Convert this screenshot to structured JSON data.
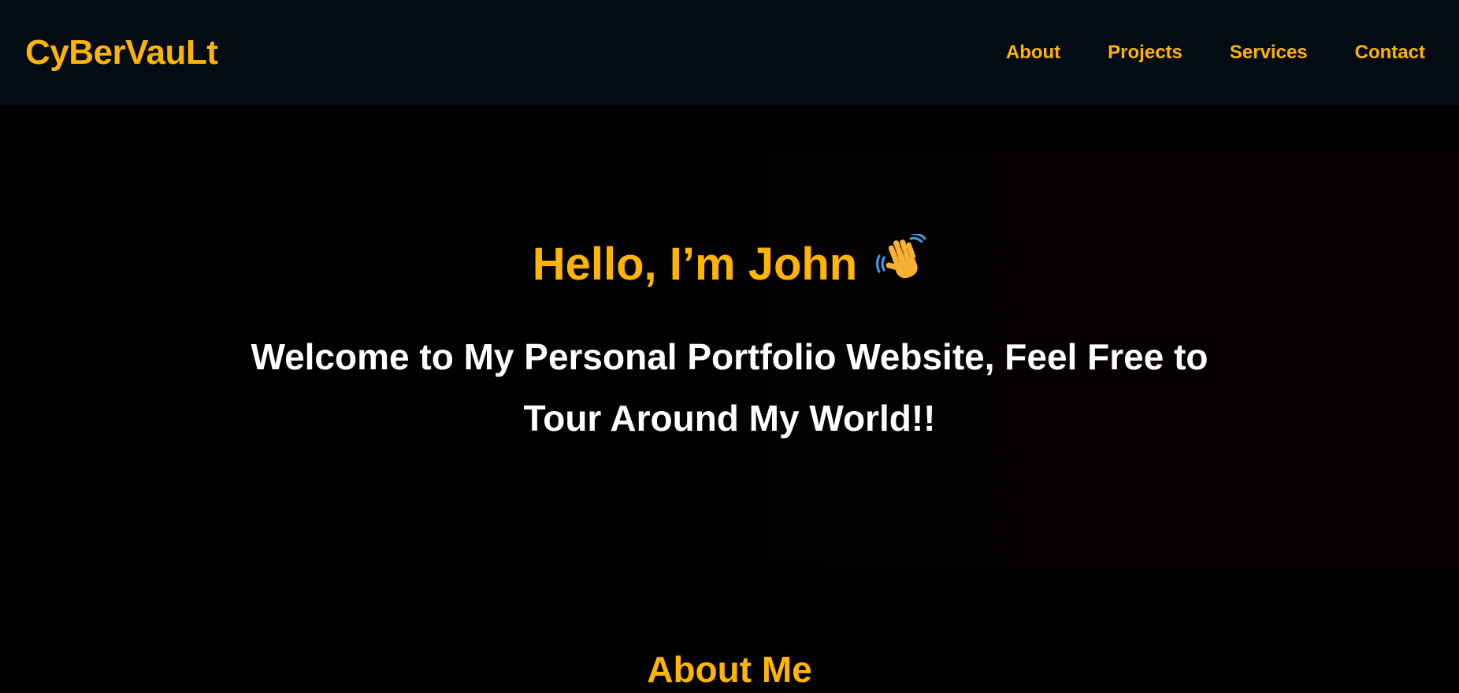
{
  "navbar": {
    "logo": "CyBerVauLt",
    "links": [
      {
        "label": "About"
      },
      {
        "label": "Projects"
      },
      {
        "label": "Services"
      },
      {
        "label": "Contact"
      }
    ]
  },
  "hero": {
    "greeting": "Hello, I’m John",
    "greeting_icon": "waving-hand-icon",
    "tagline": "Welcome to My Personal Portfolio Website, Feel Free to Tour Around My World!!"
  },
  "about": {
    "heading": "About Me"
  },
  "colors": {
    "accent": "#ffb400",
    "navbar_bg": "#030b14",
    "page_bg": "#000000",
    "text": "#ffffff"
  }
}
